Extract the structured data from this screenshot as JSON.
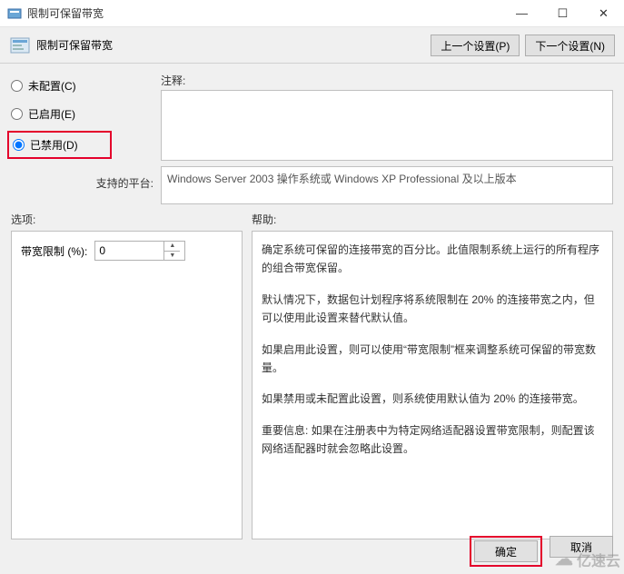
{
  "window": {
    "title": "限制可保留带宽",
    "subtitle": "限制可保留带宽"
  },
  "nav": {
    "prev": "上一个设置(P)",
    "next": "下一个设置(N)"
  },
  "radios": {
    "unconfigured": "未配置(C)",
    "enabled": "已启用(E)",
    "disabled": "已禁用(D)"
  },
  "labels": {
    "comment": "注释:",
    "supported": "支持的平台:",
    "options": "选项:",
    "help": "帮助:",
    "bandwidth": "带宽限制 (%):"
  },
  "supported_text": "Windows Server 2003 操作系统或 Windows XP Professional 及以上版本",
  "bandwidth_value": "0",
  "help_text": {
    "p1": "确定系统可保留的连接带宽的百分比。此值限制系统上运行的所有程序的组合带宽保留。",
    "p2": "默认情况下，数据包计划程序将系统限制在 20% 的连接带宽之内，但可以使用此设置来替代默认值。",
    "p3": "如果启用此设置，则可以使用“带宽限制”框来调整系统可保留的带宽数量。",
    "p4": "如果禁用或未配置此设置，则系统使用默认值为 20% 的连接带宽。",
    "p5": "重要信息: 如果在注册表中为特定网络适配器设置带宽限制，则配置该网络适配器时就会忽略此设置。"
  },
  "footer": {
    "ok": "确定",
    "cancel": "取消"
  },
  "watermark": "亿速云"
}
